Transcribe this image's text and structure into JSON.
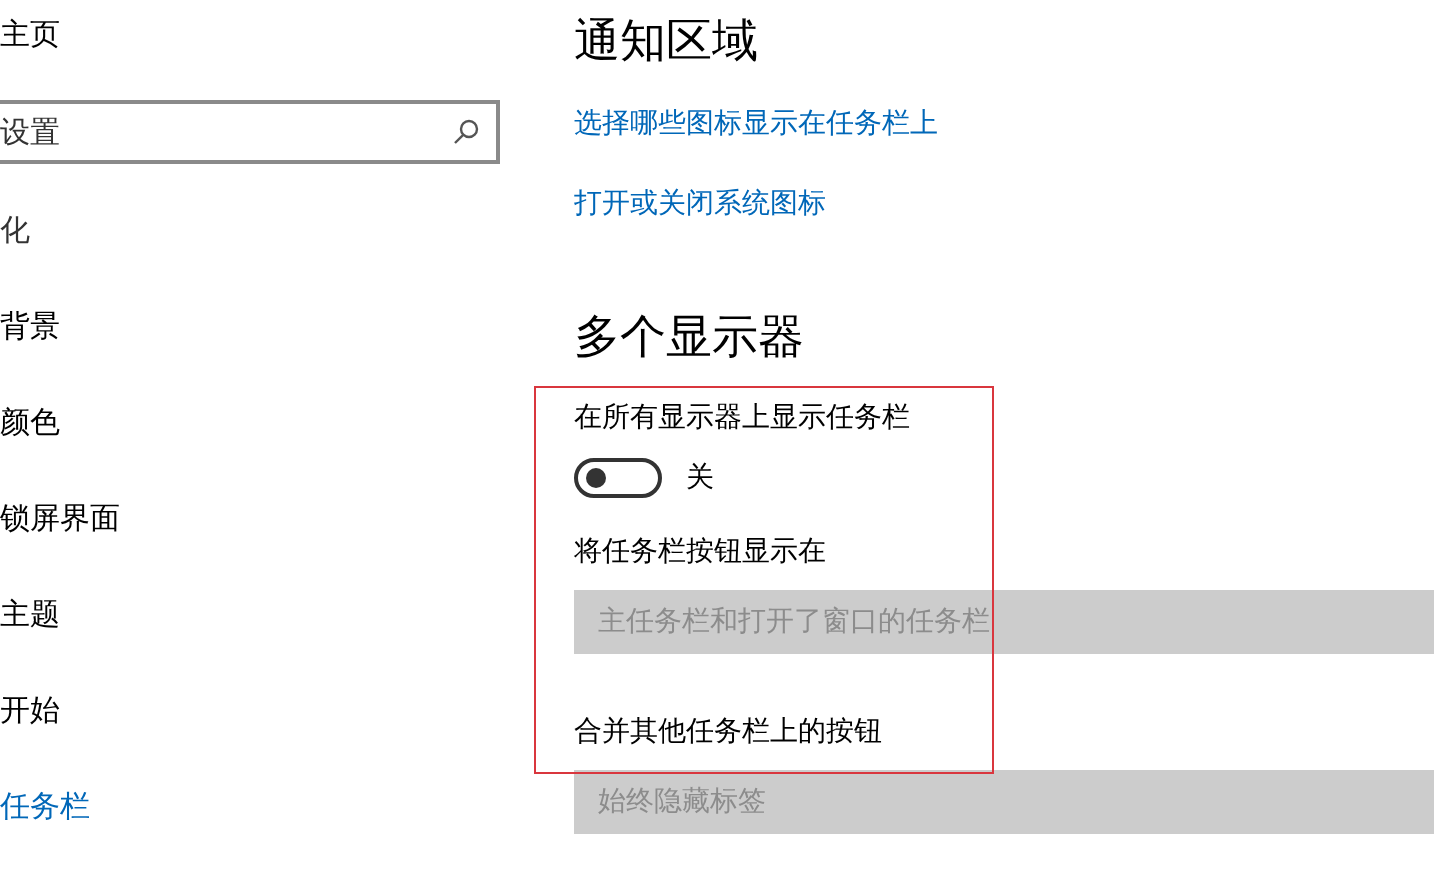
{
  "sidebar": {
    "home": "主页",
    "search": {
      "placeholder": "设置"
    },
    "section": "化",
    "items": [
      {
        "label": "背景",
        "selected": false
      },
      {
        "label": "颜色",
        "selected": false
      },
      {
        "label": "锁屏界面",
        "selected": false
      },
      {
        "label": "主题",
        "selected": false
      },
      {
        "label": "开始",
        "selected": false
      },
      {
        "label": "任务栏",
        "selected": true
      }
    ]
  },
  "notification_area": {
    "title": "通知区域",
    "links": [
      "选择哪些图标显示在任务栏上",
      "打开或关闭系统图标"
    ]
  },
  "multiple_displays": {
    "title": "多个显示器",
    "show_taskbar": {
      "label": "在所有显示器上显示任务栏",
      "on": false,
      "state_text": "关"
    },
    "dropdowns": [
      {
        "label": "将任务栏按钮显示在",
        "value": "主任务栏和打开了窗口的任务栏",
        "disabled": true
      },
      {
        "label": "合并其他任务栏上的按钮",
        "value": "始终隐藏标签",
        "disabled": true
      }
    ]
  }
}
